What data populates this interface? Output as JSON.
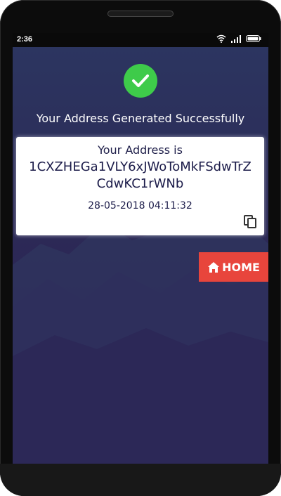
{
  "status_bar": {
    "time": "2:36"
  },
  "result": {
    "headline": "Your Address Generated Successfully",
    "success_icon": "check-circle-icon"
  },
  "card": {
    "label": "Your Address is",
    "address": "1CXZHEGa1VLY6xJWoToMkFSdwTrZCdwKC1rWNb",
    "timestamp": "28-05-2018 04:11:32",
    "copy_icon": "copy-icon"
  },
  "home_button": {
    "label": "HOME",
    "icon": "home-icon",
    "color": "#e8453c"
  },
  "colors": {
    "success": "#3ecb4a",
    "background": "#2b2a58",
    "text_dark": "#1c1c4a"
  }
}
